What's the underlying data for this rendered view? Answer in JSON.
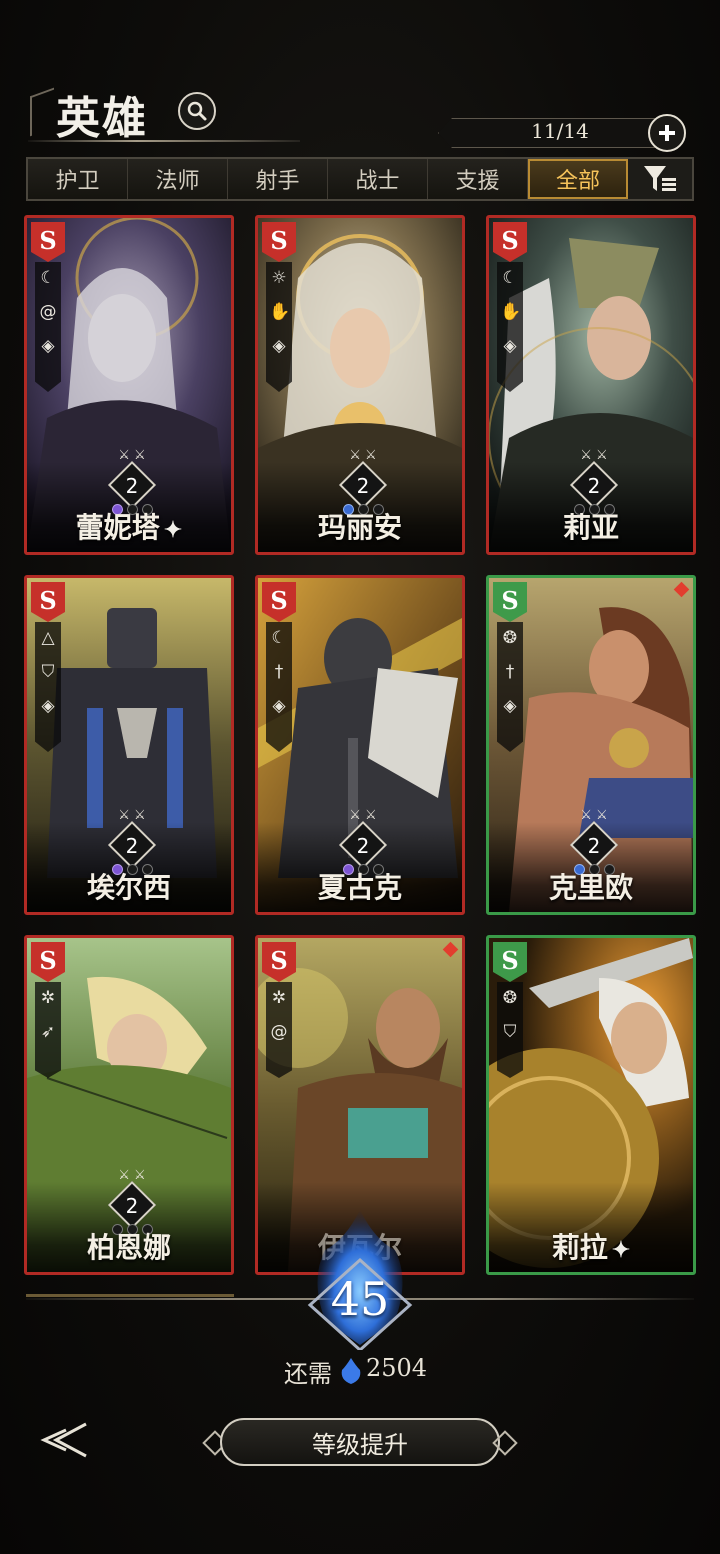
{
  "header": {
    "title": "英雄",
    "count": "11/14"
  },
  "tabs": [
    {
      "label": "护卫",
      "active": false
    },
    {
      "label": "法师",
      "active": false
    },
    {
      "label": "射手",
      "active": false
    },
    {
      "label": "战士",
      "active": false
    },
    {
      "label": "支援",
      "active": false
    },
    {
      "label": "全部",
      "active": true
    }
  ],
  "heroes": [
    {
      "name": "蕾妮塔",
      "rank": "S",
      "frame": "red",
      "level": "2",
      "starred": true,
      "icons": [
        "moon-horns-icon",
        "swirl-icon",
        "dragon-icon"
      ],
      "gem": "purple"
    },
    {
      "name": "玛丽安",
      "rank": "S",
      "frame": "red",
      "level": "2",
      "starred": false,
      "icons": [
        "sun-icon",
        "hand-icon",
        "dragon-icon"
      ],
      "gem": "blue"
    },
    {
      "name": "莉亚",
      "rank": "S",
      "frame": "red",
      "level": "2",
      "starred": false,
      "icons": [
        "moon-horns-icon",
        "hand-icon",
        "dragon-icon"
      ],
      "gem": "none"
    },
    {
      "name": "埃尔西",
      "rank": "S",
      "frame": "red",
      "level": "2",
      "starred": false,
      "icons": [
        "triangle-icon",
        "shield-icon",
        "dragon-icon"
      ],
      "gem": "purple"
    },
    {
      "name": "夏古克",
      "rank": "S",
      "frame": "red",
      "level": "2",
      "starred": false,
      "icons": [
        "moon-horns-icon",
        "sword-icon",
        "dragon-icon"
      ],
      "gem": "purple"
    },
    {
      "name": "克里欧",
      "rank": "S",
      "frame": "green",
      "level": "2",
      "starred": false,
      "icons": [
        "flower-icon",
        "sword-icon",
        "dragon-icon"
      ],
      "gem": "blue"
    },
    {
      "name": "柏恩娜",
      "rank": "S",
      "frame": "red",
      "level": "2",
      "starred": false,
      "icons": [
        "tree-icon",
        "bow-icon"
      ],
      "gem": "none"
    },
    {
      "name": "伊瓦尔",
      "rank": "S",
      "frame": "red",
      "level": "",
      "starred": false,
      "icons": [
        "tree-icon",
        "swirl-icon"
      ],
      "gem": "none"
    },
    {
      "name": "莉拉",
      "rank": "S",
      "frame": "green",
      "level": "",
      "starred": true,
      "icons": [
        "flower-icon",
        "shield-icon"
      ],
      "gem": "none"
    }
  ],
  "footer": {
    "level": "45",
    "need_label": "还需",
    "need_value": "2504",
    "upgrade_label": "等级提升"
  },
  "colors": {
    "red_frame": "#b12a24",
    "green_frame": "#3a9a48",
    "active_tab": "#f6c35a",
    "level_glow": "#4a8cff"
  }
}
